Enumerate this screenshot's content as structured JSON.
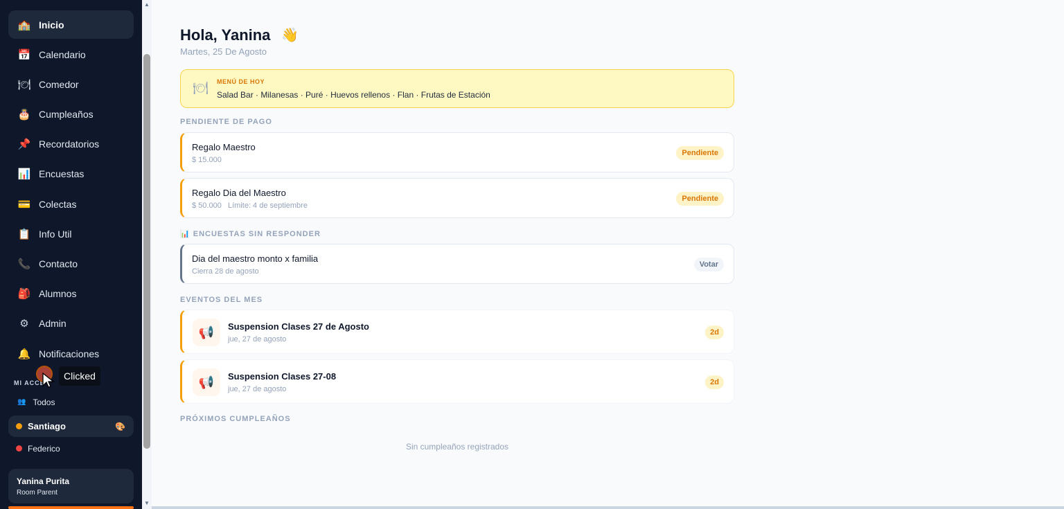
{
  "sidebar": {
    "nav": [
      {
        "label": "Inicio",
        "icon": "🏫",
        "icon_name": "school-icon"
      },
      {
        "label": "Calendario",
        "icon": "📅",
        "icon_name": "calendar-icon"
      },
      {
        "label": "Comedor",
        "icon": "🍽",
        "icon_name": "plate-icon"
      },
      {
        "label": "Cumpleaños",
        "icon": "🎂",
        "icon_name": "cake-icon"
      },
      {
        "label": "Recordatorios",
        "icon": "📌",
        "icon_name": "pin-icon"
      },
      {
        "label": "Encuestas",
        "icon": "📊",
        "icon_name": "bar-chart-icon"
      },
      {
        "label": "Colectas",
        "icon": "💳",
        "icon_name": "credit-card-icon"
      },
      {
        "label": "Info Util",
        "icon": "📋",
        "icon_name": "clipboard-icon"
      },
      {
        "label": "Contacto",
        "icon": "📞",
        "icon_name": "phone-icon"
      },
      {
        "label": "Alumnos",
        "icon": "🎒",
        "icon_name": "backpack-icon"
      },
      {
        "label": "Admin",
        "icon": "⚙",
        "icon_name": "gear-icon"
      },
      {
        "label": "Notificaciones",
        "icon": "🔔",
        "icon_name": "bell-icon"
      }
    ],
    "section_label": "MI ACCE",
    "children": [
      {
        "label": "Todos",
        "icon": "👥"
      },
      {
        "label": "Santiago",
        "dot_color": "#f59e0b"
      },
      {
        "label": "Federico",
        "dot_color": "#ef4444"
      }
    ],
    "palette_icon": "🎨",
    "user": {
      "name": "Yanina Purita",
      "role": "Room Parent"
    }
  },
  "overlay": {
    "tooltip": "Clicked"
  },
  "main": {
    "greeting": "Hola, Yanina",
    "wave": "👋",
    "date": "Martes, 25 De Agosto",
    "menu": {
      "icon": "🍽",
      "label": "MENÚ DE HOY",
      "items": "Salad Bar · Milanesas · Puré · Huevos rellenos · Flan · Frutas de Estación"
    },
    "pending_heading": "PENDIENTE DE PAGO",
    "pending": [
      {
        "title": "Regalo Maestro",
        "sub": "$ 15.000",
        "badge": "Pendiente"
      },
      {
        "title": "Regalo Dia del Maestro",
        "sub": "$ 50.000   Límite: 4 de septiembre",
        "badge": "Pendiente"
      }
    ],
    "surveys_heading": "📊 ENCUESTAS SIN RESPONDER",
    "surveys": [
      {
        "title": "Dia del maestro monto x familia",
        "sub": "Cierra 28 de agosto",
        "badge": "Votar"
      }
    ],
    "events_heading": "EVENTOS DEL MES",
    "events": [
      {
        "title": "Suspension Clases 27 de Agosto",
        "date": "jue, 27 de agosto",
        "badge": "2d",
        "icon": "📢"
      },
      {
        "title": "Suspension Clases 27-08",
        "date": "jue, 27 de agosto",
        "badge": "2d",
        "icon": "📢"
      }
    ],
    "birthdays_heading": "PRÓXIMOS CUMPLEAÑOS",
    "birthdays_empty": "Sin cumpleaños registrados"
  },
  "colors": {
    "sidebar_bg": "#0f172a",
    "accent": "#f59e0b",
    "menu_bg": "#fef9c3"
  }
}
